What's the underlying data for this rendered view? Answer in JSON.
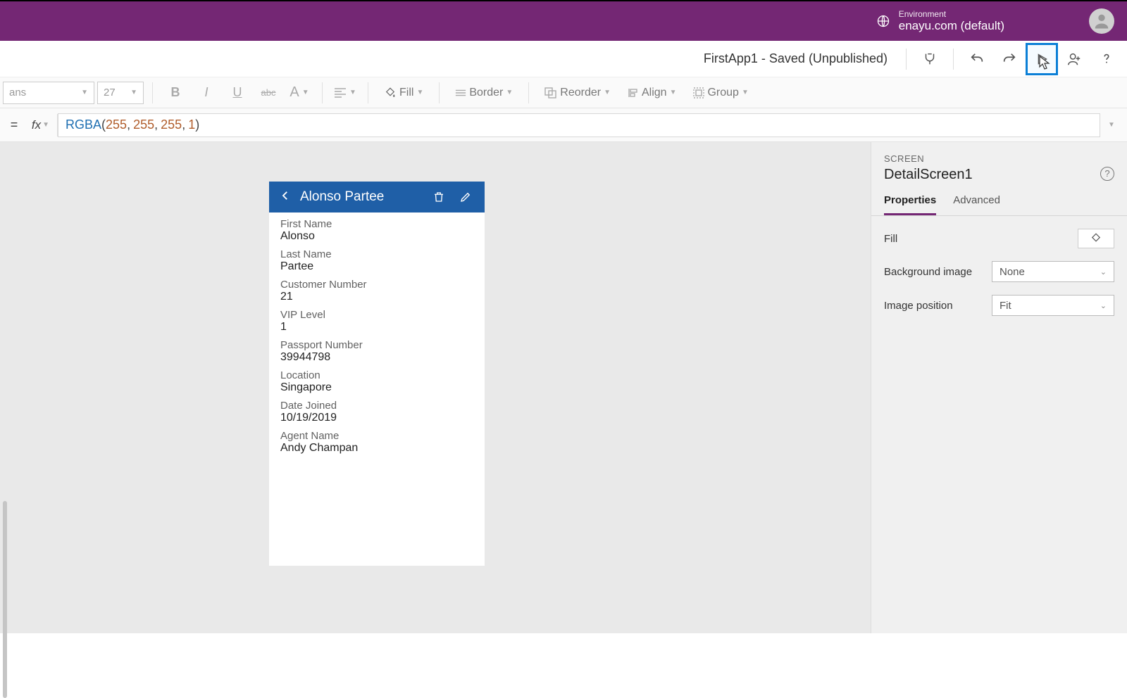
{
  "header": {
    "env_label": "Environment",
    "env_name": "enayu.com (default)"
  },
  "command": {
    "app_title": "FirstApp1 - Saved (Unpublished)"
  },
  "toolbar": {
    "font": "ans",
    "size": "27",
    "fill_label": "Fill",
    "border_label": "Border",
    "reorder_label": "Reorder",
    "align_label": "Align",
    "group_label": "Group"
  },
  "formula": {
    "fn": "RGBA",
    "args": [
      "255",
      "255",
      "255",
      "1"
    ]
  },
  "detail": {
    "title": "Alonso Partee",
    "fields": [
      {
        "label": "First Name",
        "value": "Alonso"
      },
      {
        "label": "Last Name",
        "value": "Partee"
      },
      {
        "label": "Customer Number",
        "value": "21"
      },
      {
        "label": "VIP Level",
        "value": "1"
      },
      {
        "label": "Passport Number",
        "value": "39944798"
      },
      {
        "label": "Location",
        "value": "Singapore"
      },
      {
        "label": "Date Joined",
        "value": "10/19/2019"
      },
      {
        "label": "Agent Name",
        "value": "Andy Champan"
      }
    ]
  },
  "props": {
    "kind": "SCREEN",
    "name": "DetailScreen1",
    "tabs": {
      "properties": "Properties",
      "advanced": "Advanced"
    },
    "rows": {
      "fill_label": "Fill",
      "bg_label": "Background image",
      "bg_value": "None",
      "imgpos_label": "Image position",
      "imgpos_value": "Fit"
    }
  }
}
